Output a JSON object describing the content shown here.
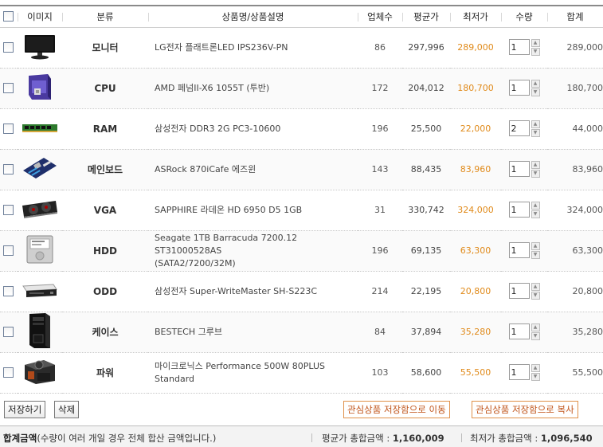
{
  "header": {
    "image": "이미지",
    "category": "분류",
    "product": "상품명/상품설명",
    "sellers": "업체수",
    "avg_price": "평균가",
    "min_price": "최저가",
    "qty": "수량",
    "total": "합계"
  },
  "items": [
    {
      "category": "모니터",
      "name": "LG전자 플래트론LED IPS236V-PN",
      "name2": "",
      "sellers": "86",
      "avg": "297,996",
      "min": "289,000",
      "qty": "1",
      "sum": "289,000",
      "icon": "monitor-icon"
    },
    {
      "category": "CPU",
      "name": "AMD 페넘II-X6 1055T (투반)",
      "name2": "",
      "sellers": "172",
      "avg": "204,012",
      "min": "180,700",
      "qty": "1",
      "sum": "180,700",
      "icon": "cpu-box-icon"
    },
    {
      "category": "RAM",
      "name": "삼성전자 DDR3 2G PC3-10600",
      "name2": "",
      "sellers": "196",
      "avg": "25,500",
      "min": "22,000",
      "qty": "2",
      "sum": "44,000",
      "icon": "ram-icon"
    },
    {
      "category": "메인보드",
      "name": "ASRock 870iCafe 에즈윈",
      "name2": "",
      "sellers": "143",
      "avg": "88,435",
      "min": "83,960",
      "qty": "1",
      "sum": "83,960",
      "icon": "mainboard-icon"
    },
    {
      "category": "VGA",
      "name": "SAPPHIRE 라데온 HD 6950 D5 1GB",
      "name2": "",
      "sellers": "31",
      "avg": "330,742",
      "min": "324,000",
      "qty": "1",
      "sum": "324,000",
      "icon": "vga-card-icon"
    },
    {
      "category": "HDD",
      "name": "Seagate 1TB Barracuda 7200.12 ST31000528AS",
      "name2": "(SATA2/7200/32M)",
      "sellers": "196",
      "avg": "69,135",
      "min": "63,300",
      "qty": "1",
      "sum": "63,300",
      "icon": "hdd-icon"
    },
    {
      "category": "ODD",
      "name": "삼성전자 Super-WriteMaster SH-S223C",
      "name2": "",
      "sellers": "214",
      "avg": "22,195",
      "min": "20,800",
      "qty": "1",
      "sum": "20,800",
      "icon": "odd-drive-icon"
    },
    {
      "category": "케이스",
      "name": "BESTECH 그루브",
      "name2": "",
      "sellers": "84",
      "avg": "37,894",
      "min": "35,280",
      "qty": "1",
      "sum": "35,280",
      "icon": "case-icon"
    },
    {
      "category": "파워",
      "name": "마이크로닉스 Performance 500W 80PLUS",
      "name2": "Standard",
      "sellers": "103",
      "avg": "58,600",
      "min": "55,500",
      "qty": "1",
      "sum": "55,500",
      "icon": "power-supply-icon"
    }
  ],
  "buttons": {
    "save": "저장하기",
    "delete": "삭제",
    "move": "관심상품 저장함으로 이동",
    "copy": "관심상품 저장함으로 복사"
  },
  "footer": {
    "title": "합계금액",
    "note": "(수량이 여러 개일 경우 전체 합산 금액입니다.)",
    "avg_label": "평균가 총합금액 : ",
    "avg_total": "1,160,009",
    "min_label": "최저가 총합금액 : ",
    "min_total": "1,096,540"
  },
  "colors": {
    "min_price": "#e08a1a",
    "orange_button_border": "#e0914a",
    "orange_button_text": "#c0541a"
  }
}
